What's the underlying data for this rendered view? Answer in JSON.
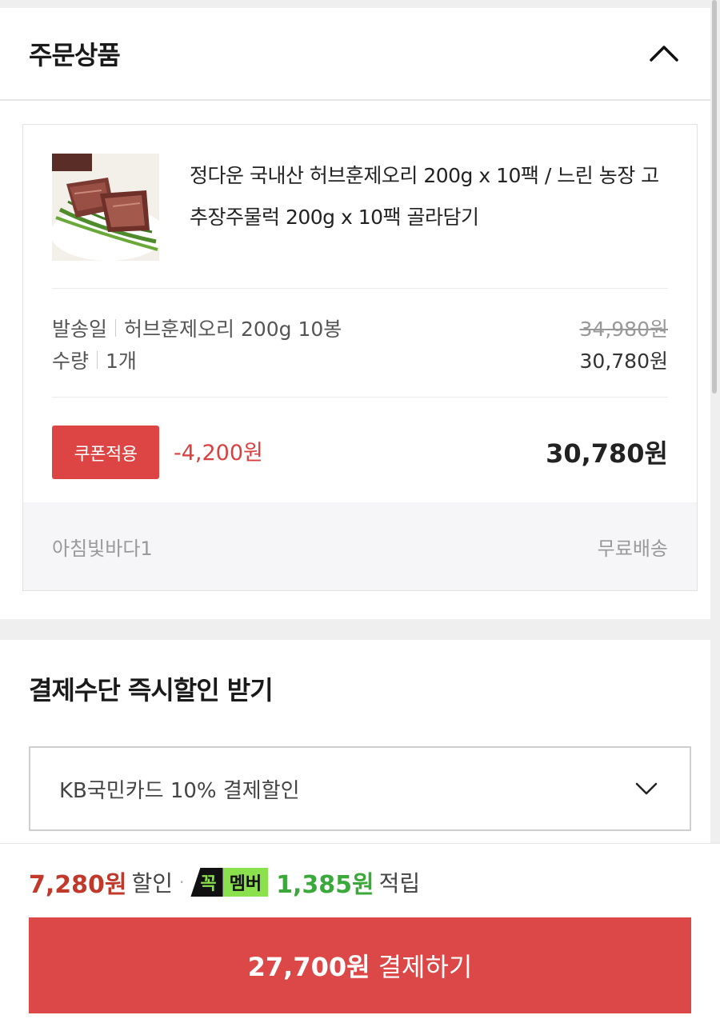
{
  "order_section": {
    "title": "주문상품",
    "collapse_icon": "chevron-up-icon"
  },
  "product": {
    "name": "정다운 국내산 허브훈제오리 200g x 10팩 / 느린 농장 고추장주물럭 200g x 10팩 골라담기",
    "option_label": "발송일",
    "option_value": "허브훈제오리 200g 10봉",
    "qty_label": "수량",
    "qty_value": "1개",
    "original_price": "34,980원",
    "sale_price": "30,780원",
    "coupon_button": "쿠폰적용",
    "coupon_discount": "-4,200원",
    "final_price": "30,780원",
    "seller": "아침빛바다1",
    "shipping": "무료배송"
  },
  "payment_section": {
    "title": "결제수단 즉시할인 받기",
    "selected_option": "KB국민카드 10% 결제할인",
    "dropdown_icon": "chevron-down-icon"
  },
  "bottom_bar": {
    "discount_amount": "7,280원",
    "discount_label": "할인",
    "separator": "·",
    "member_badge_left": "꼭",
    "member_badge_right": "멤버",
    "points_amount": "1,385원",
    "points_label": "적립",
    "pay_amount": "27,700원",
    "pay_label": "결제하기"
  },
  "colors": {
    "accent_red": "#dc4848",
    "discount_red": "#d94040",
    "member_green": "#8be04e",
    "point_green": "#3aa83a"
  }
}
